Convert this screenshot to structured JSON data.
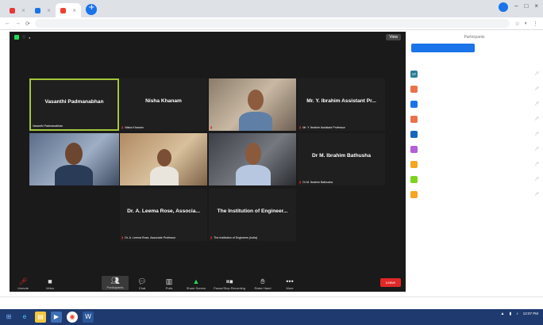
{
  "browser": {
    "tabs": [
      {
        "title": "",
        "color": "#e53935"
      },
      {
        "title": "",
        "color": "#1a73e8"
      },
      {
        "title": "",
        "color": "#ea4335"
      }
    ],
    "url": ""
  },
  "meeting": {
    "view_button": "View",
    "participants": [
      {
        "display": "Vasanthi Padmanabhan",
        "label": "Vasanthi Padmanabhan",
        "video": false,
        "active": true,
        "muted": false
      },
      {
        "display": "Nisha Khanam",
        "label": "Nisha Khanam",
        "video": false,
        "active": false,
        "muted": true
      },
      {
        "display": "",
        "label": "",
        "video": true,
        "active": false,
        "muted": true
      },
      {
        "display": "Mr. Y. Ibrahim Assistant Pr...",
        "label": "Mr. Y. Ibrahim Assistant Professor",
        "video": false,
        "active": false,
        "muted": true
      },
      {
        "display": "",
        "label": "",
        "video": true,
        "active": false,
        "muted": false
      },
      {
        "display": "",
        "label": "",
        "video": true,
        "active": false,
        "muted": false
      },
      {
        "display": "",
        "label": "",
        "video": true,
        "active": false,
        "muted": false
      },
      {
        "display": "Dr M. Ibrahim Bathusha",
        "label": "Dr M. Ibrahim Bathusha",
        "video": false,
        "active": false,
        "muted": true
      },
      {
        "display": "Dr. A. Leema Rose, Associa...",
        "label": "Dr. A. Leema Rose, Associate Professor",
        "video": false,
        "active": false,
        "muted": true
      },
      {
        "display": "The Institution of Engineer...",
        "label": "The Institution of Engineers (India)",
        "video": false,
        "active": false,
        "muted": true
      }
    ],
    "toolbar": [
      {
        "label": "Unmute",
        "icon": "microphone-icon"
      },
      {
        "label": "Video",
        "icon": "video-camera-icon"
      },
      {
        "label": "Participants",
        "icon": "participants-icon",
        "count": "20"
      },
      {
        "label": "Chat",
        "icon": "chat-icon"
      },
      {
        "label": "Polls",
        "icon": "polls-icon"
      },
      {
        "label": "Share Screen",
        "icon": "share-screen-icon"
      },
      {
        "label": "Pause/Stop Recording",
        "icon": "recording-icon"
      },
      {
        "label": "Raise Hand",
        "icon": "raise-hand-icon"
      },
      {
        "label": "More",
        "icon": "more-icon"
      }
    ],
    "leave_label": "Leave"
  },
  "panel": {
    "title": "Participants",
    "tab_active": "",
    "tab_inactive": "",
    "rows": [
      {
        "initials": "VP",
        "color": "#2d7d9a",
        "name": ""
      },
      {
        "initials": "",
        "color": "#e8734a",
        "name": ""
      },
      {
        "initials": "",
        "color": "#1a73e8",
        "name": ""
      },
      {
        "initials": "",
        "color": "#e8734a",
        "name": ""
      },
      {
        "initials": "",
        "color": "#1565c0",
        "name": ""
      },
      {
        "initials": "",
        "color": "#b25fd8",
        "name": ""
      },
      {
        "initials": "",
        "color": "#f5a623",
        "name": ""
      },
      {
        "initials": "",
        "color": "#7ed321",
        "name": ""
      },
      {
        "initials": "",
        "color": "#f5a623",
        "name": ""
      }
    ],
    "bottom": [
      "",
      "",
      ""
    ]
  },
  "downloads": {
    "items": [
      "",
      ""
    ],
    "show_all": ""
  },
  "taskbar": {
    "time": "12:07 PM",
    "date": ""
  }
}
